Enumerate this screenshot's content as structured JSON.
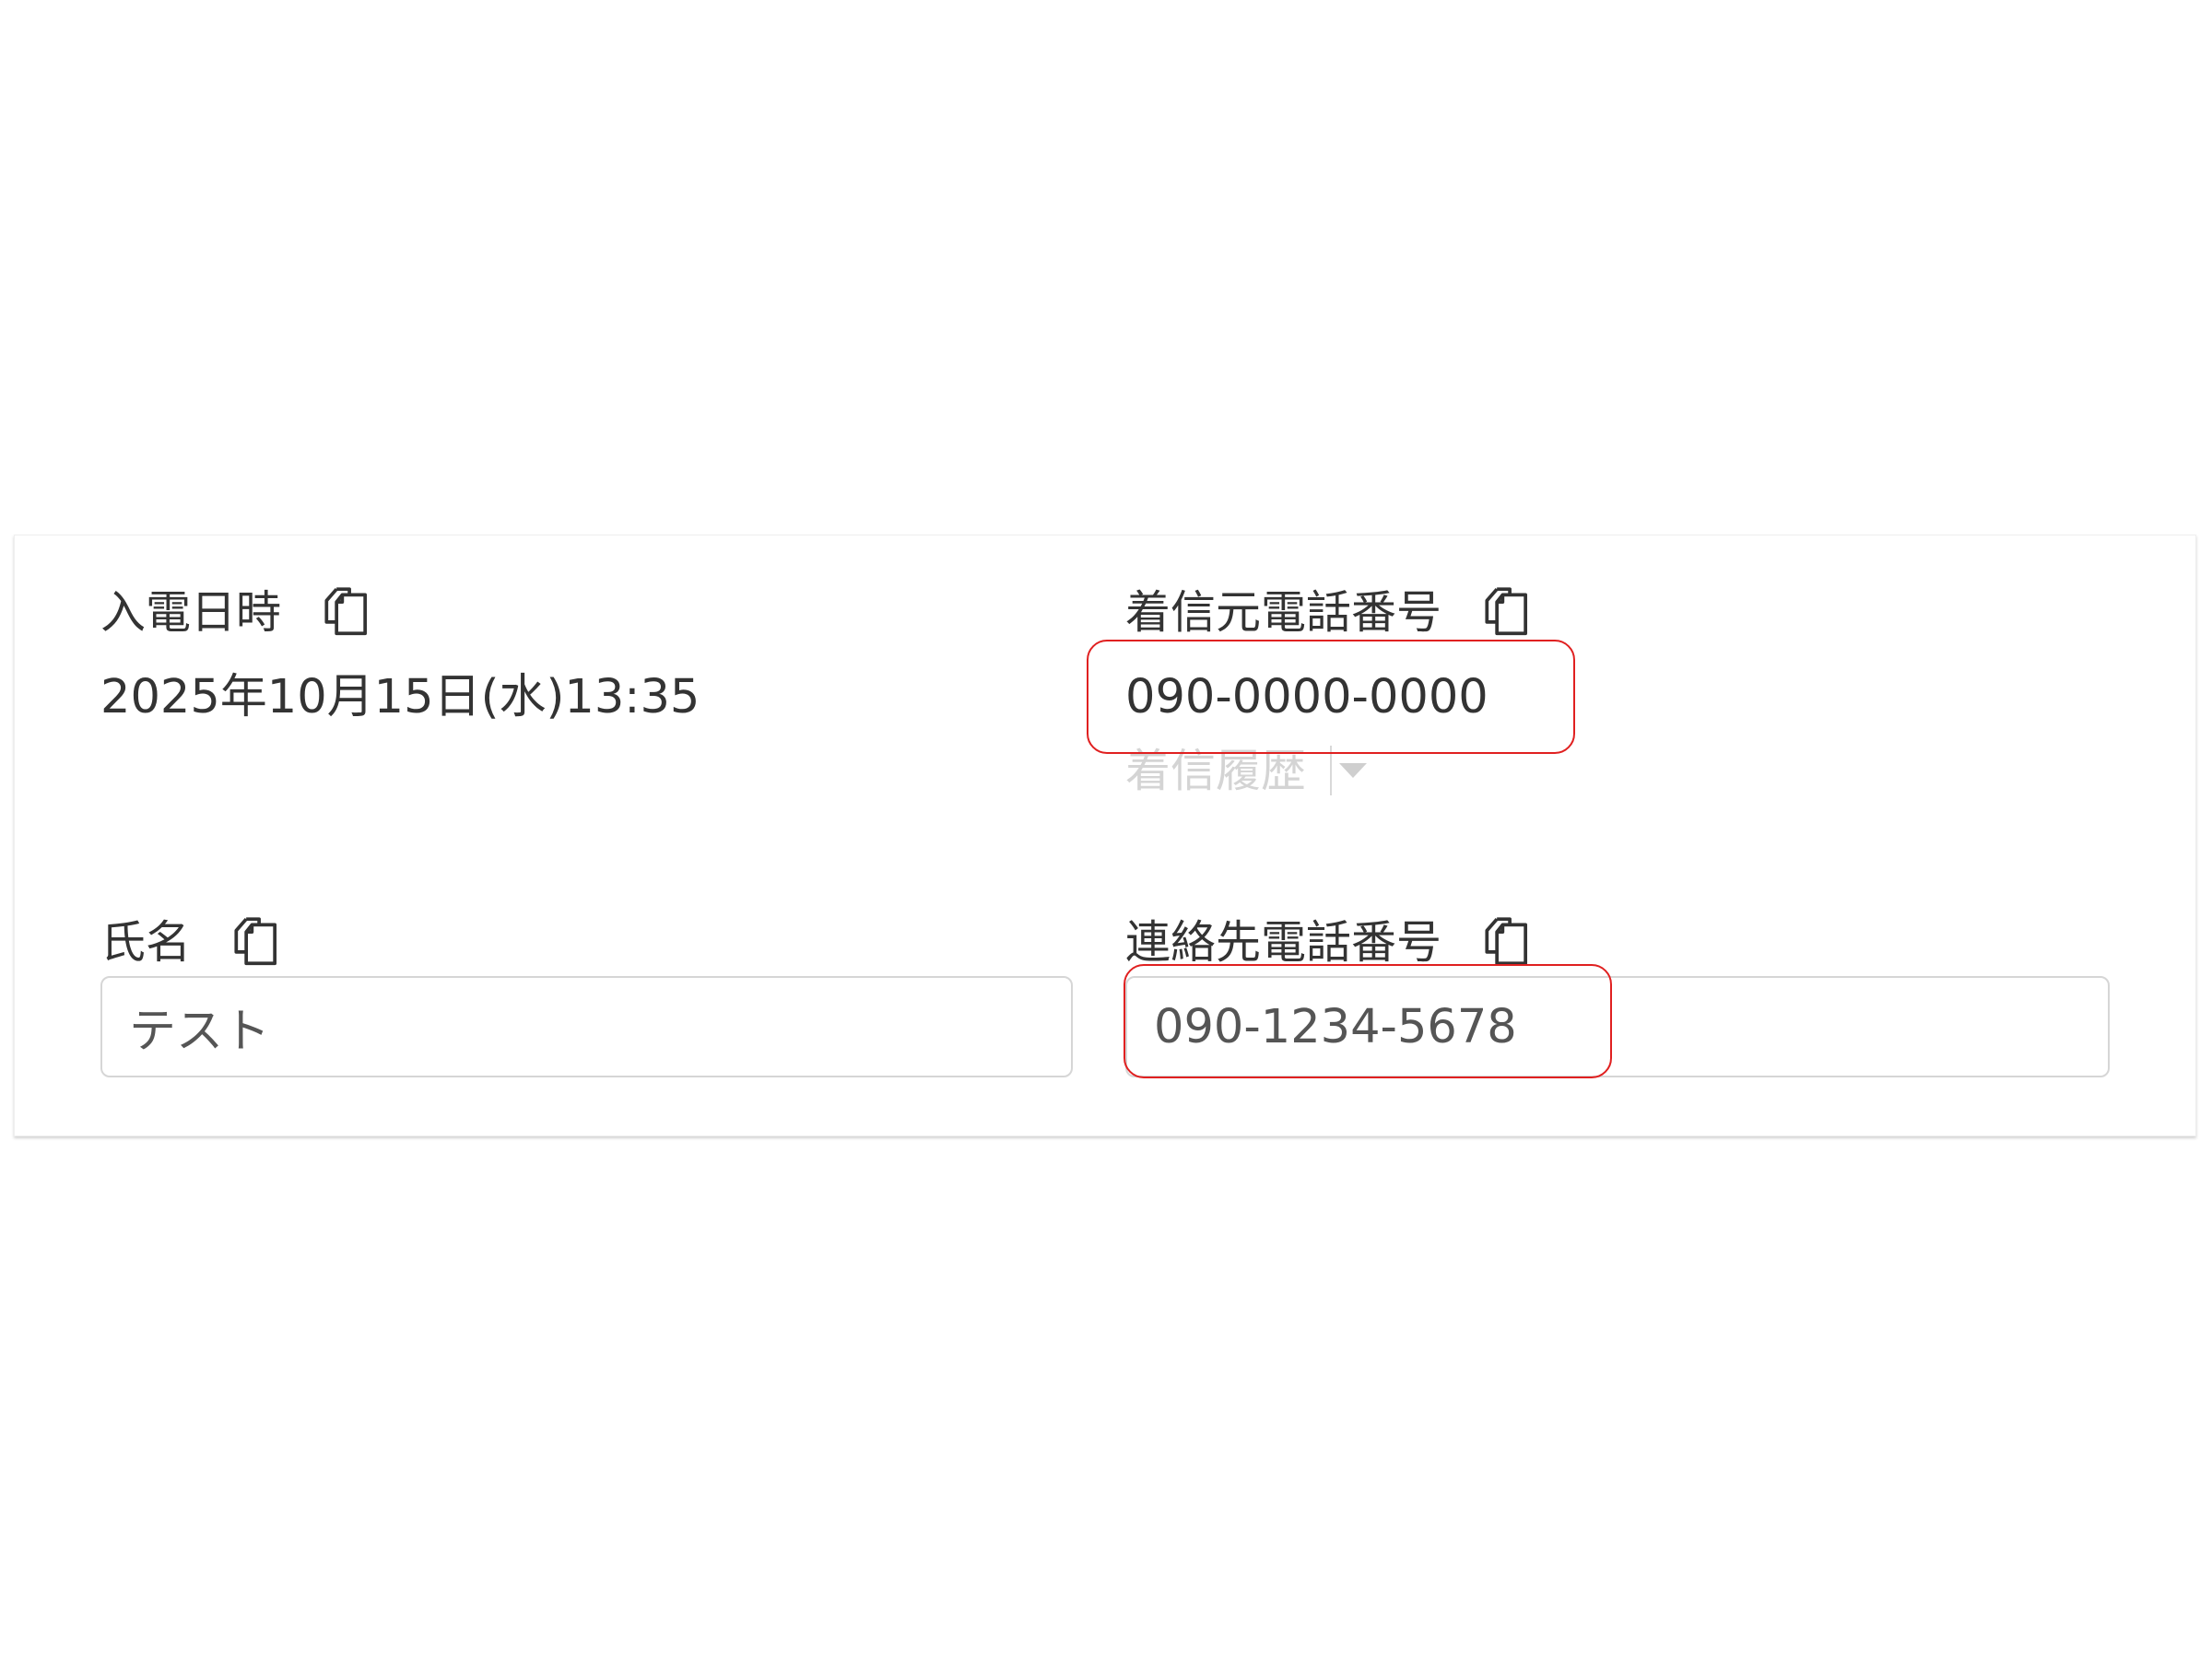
{
  "fields": {
    "call_datetime": {
      "label": "入電日時",
      "value": "2025年10月15日(水)13:35"
    },
    "incoming_phone": {
      "label": "着信元電話番号",
      "value": "090-0000-0000",
      "history_label": "着信履歴"
    },
    "name": {
      "label": "氏名",
      "value": "テスト"
    },
    "contact_phone": {
      "label": "連絡先電話番号",
      "value": "090-1234-5678"
    }
  },
  "icons": {
    "copy": "copy-icon",
    "dropdown": "caret-down-icon"
  },
  "colors": {
    "highlight": "#e02020",
    "history_text": "#d4d4d4",
    "input_border": "#d6d6d6"
  }
}
